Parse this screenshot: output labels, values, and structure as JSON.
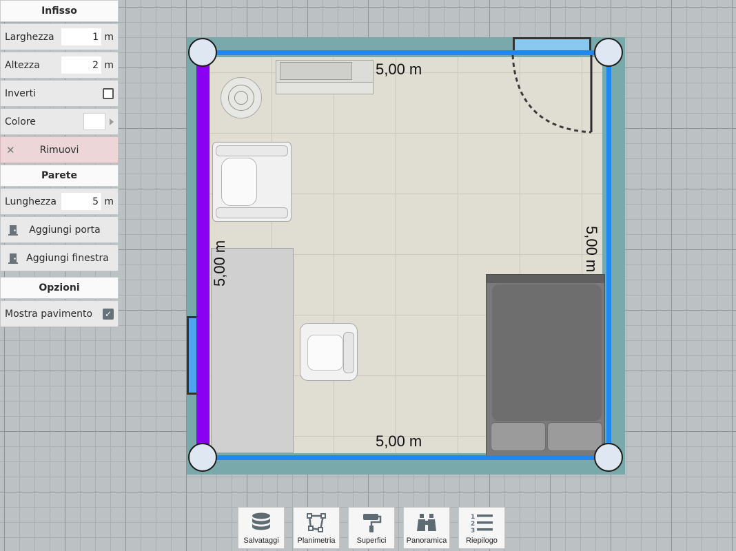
{
  "panel": {
    "infisso": {
      "title": "Infisso",
      "larghezza_label": "Larghezza",
      "larghezza_value": "1",
      "larghezza_unit": "m",
      "altezza_label": "Altezza",
      "altezza_value": "2",
      "altezza_unit": "m",
      "inverti_label": "Inverti",
      "inverti_checked": false,
      "colore_label": "Colore",
      "colore_value": "#ffffff",
      "rimuovi_label": "Rimuovi"
    },
    "parete": {
      "title": "Parete",
      "lunghezza_label": "Lunghezza",
      "lunghezza_value": "5",
      "lunghezza_unit": "m",
      "aggiungi_porta_label": "Aggiungi porta",
      "aggiungi_finestra_label": "Aggiungi finestra"
    },
    "opzioni": {
      "title": "Opzioni",
      "mostra_pavimento_label": "Mostra pavimento",
      "mostra_pavimento_checked": true
    }
  },
  "plan": {
    "dim_top": "5,00 m",
    "dim_bottom": "5,00 m",
    "dim_left": "5,00 m",
    "dim_right": "5,00 m",
    "colors": {
      "wall": "#1e88f0",
      "selected_wall": "#8a00f2",
      "wall_outline": "#79a9aa",
      "floor": "#e0ddd3",
      "node": "#dfe8f2"
    }
  },
  "toolbar": {
    "items": [
      {
        "label": "Salvataggi",
        "icon": "database-icon"
      },
      {
        "label": "Planimetria",
        "icon": "polygon-icon"
      },
      {
        "label": "Superfici",
        "icon": "paint-roller-icon"
      },
      {
        "label": "Panoramica",
        "icon": "binoculars-icon"
      },
      {
        "label": "Riepilogo",
        "icon": "numbered-list-icon"
      }
    ]
  }
}
